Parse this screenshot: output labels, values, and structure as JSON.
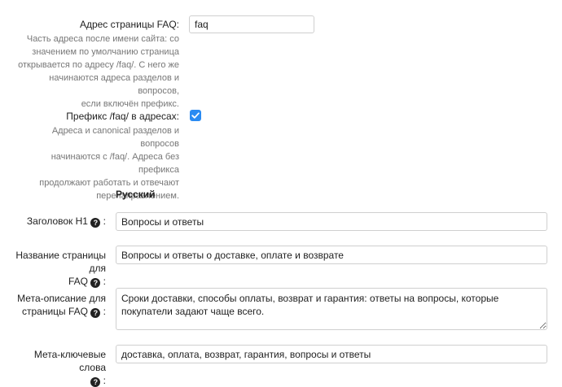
{
  "faq_url": {
    "label": "Адрес страницы FAQ:",
    "value": "faq",
    "help": [
      "Часть адреса после имени сайта: со",
      "значением по умолчанию страница",
      "открывается по адресу /faq/. С него же",
      "начинаются адреса разделов и вопросов,",
      "если включён префикс."
    ]
  },
  "prefix": {
    "label": "Префикс /faq/ в адресах:",
    "checked": true,
    "help": [
      "Адреса и canonical разделов и вопросов",
      "начинаются с /faq/. Адреса без префикса",
      "продолжают работать и отвечают",
      "перенаправлением."
    ]
  },
  "section_title": "Русский",
  "h1": {
    "label": "Заголовок H1",
    "value": "Вопросы и ответы"
  },
  "page_title": {
    "label_line1": "Название страницы для",
    "label_line2": "FAQ",
    "value": "Вопросы и ответы о доставке, оплате и возврате"
  },
  "meta_description": {
    "label_line1": "Мета-описание для",
    "label_line2": "страницы FAQ",
    "value": "Сроки доставки, способы оплаты, возврат и гарантия: ответы на вопросы, которые покупатели задают чаще всего."
  },
  "meta_keywords": {
    "label": "Мета-ключевые слова",
    "value": "доставка, оплата, возврат, гарантия, вопросы и ответы"
  },
  "colors": {
    "checkbox": "#2a8bf2",
    "help_text": "#777777",
    "border": "#cfcfcf"
  }
}
